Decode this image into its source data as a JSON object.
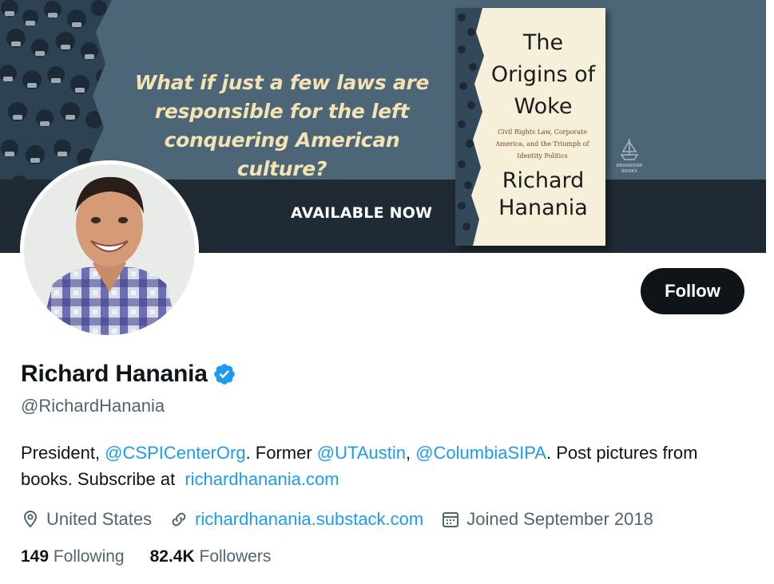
{
  "banner": {
    "tagline": "What if just a few laws are responsible for the left conquering American culture?",
    "availability": "AVAILABLE NOW",
    "book": {
      "title": "The Origins of Woke",
      "subtitle": "Civil Rights Law, Corporate America, and the Triumph of Identity Politics",
      "author": "Richard Hanania"
    },
    "publisher": "BROADSIDE BOOKS"
  },
  "profile": {
    "name": "Richard Hanania",
    "handle": "@RichardHanania",
    "follow_label": "Follow",
    "verified_icon": "verified-badge-icon",
    "bio": {
      "p1": "President, ",
      "m1": "@CSPICenterOrg",
      "p2": ". Former ",
      "m2": "@UTAustin",
      "p3": ", ",
      "m3": "@ColumbiaSIPA",
      "p4": ". Post pictures from books. Subscribe at ",
      "url": "richardhanania.com"
    },
    "location": "United States",
    "website": "richardhanania.substack.com",
    "joined": "Joined September 2018",
    "following_count": "149",
    "following_label": "Following",
    "followers_count": "82.4K",
    "followers_label": "Followers"
  },
  "colors": {
    "accent": "#1d9bf0",
    "text": "#0f1419",
    "muted": "#536471",
    "banner_bg": "#4c6678",
    "banner_band": "#1f2a34",
    "tagline": "#f3e3b3"
  }
}
